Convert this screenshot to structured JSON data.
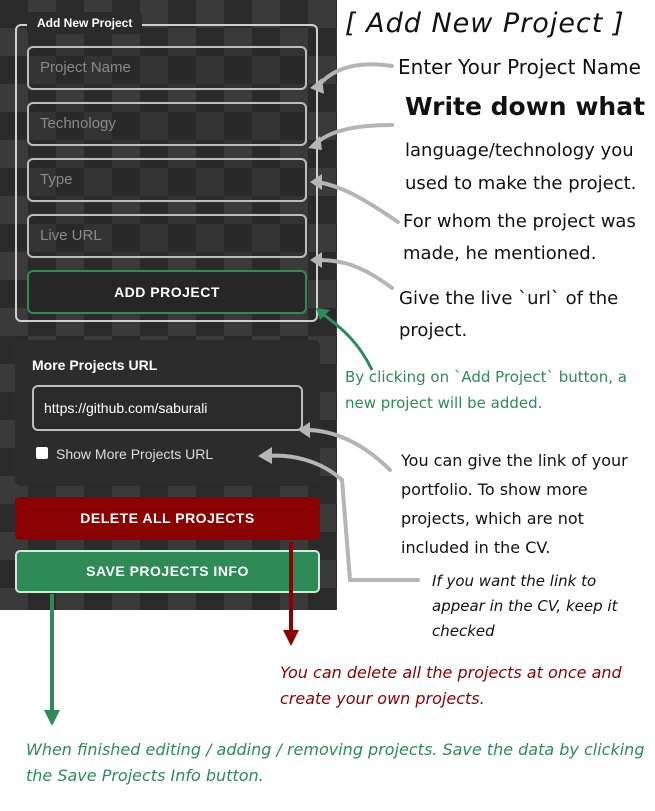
{
  "form": {
    "legend": "Add New Project",
    "project_name_placeholder": "Project Name",
    "technology_placeholder": "Technology",
    "type_placeholder": "Type",
    "live_url_placeholder": "Live URL",
    "add_button": "ADD PROJECT"
  },
  "more_projects": {
    "title": "More Projects URL",
    "url_value": "https://github.com/saburali",
    "checkbox_label": "Show More Projects URL",
    "checked": false
  },
  "buttons": {
    "delete_all": "DELETE ALL PROJECTS",
    "save_info": "SAVE PROJECTS INFO"
  },
  "annotations": {
    "heading": "[ Add New Project ]",
    "project_name": "Enter Your Project Name",
    "technology_big": "Write down what",
    "technology_rest": "language/technology you used to make the project.",
    "type": "For whom the project was made, he mentioned.",
    "live_url": "Give the live `url` of the project.",
    "add_project": "By clicking on `Add Project` button, a new project will be added.",
    "more_url": "You can give the link of your portfolio. To show more projects, which are not included in the CV.",
    "checkbox": "If you want the link to appear in the CV, keep it checked",
    "delete": "You can delete all the projects at once and create your own projects.",
    "save": "When finished editing / adding / removing projects. Save the data by clicking the Save Projects Info button."
  },
  "colors": {
    "green": "#2e8b57",
    "red": "#8b0000",
    "gray_arrow": "#b5b5b5"
  }
}
